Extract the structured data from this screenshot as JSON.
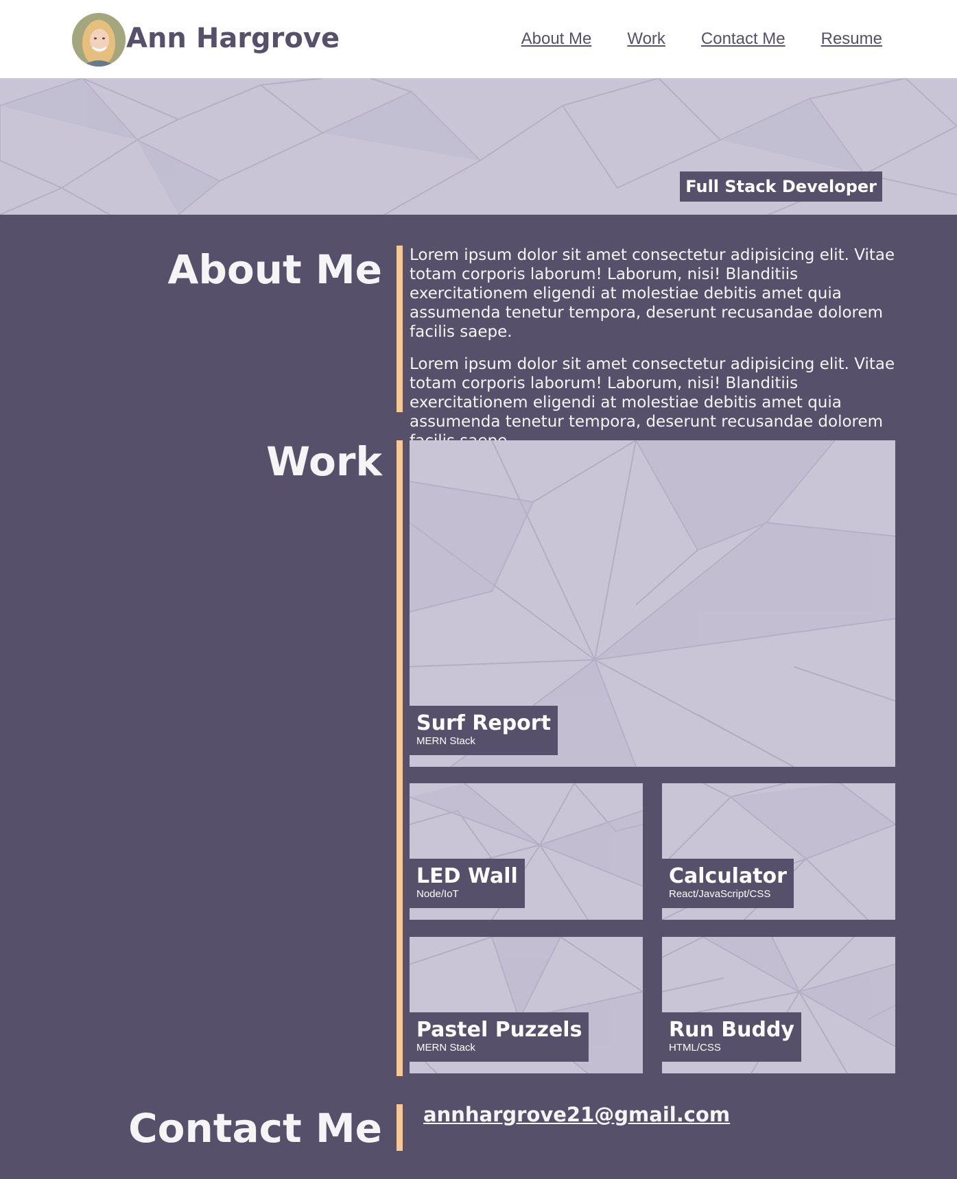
{
  "header": {
    "name": "Ann Hargrove",
    "nav": [
      {
        "label": "About Me"
      },
      {
        "label": "Work"
      },
      {
        "label": "Contact Me"
      },
      {
        "label": "Resume"
      }
    ]
  },
  "hero": {
    "badge": "Full Stack Developer"
  },
  "about": {
    "title": "About Me",
    "paragraphs": [
      "Lorem ipsum dolor sit amet consectetur adipisicing elit. Vitae totam corporis laborum! Laborum, nisi! Blanditiis exercitationem eligendi at molestiae debitis amet quia assumenda tenetur tempora, deserunt recusandae dolorem facilis saepe.",
      "Lorem ipsum dolor sit amet consectetur adipisicing elit. Vitae totam corporis laborum! Laborum, nisi! Blanditiis exercitationem eligendi at molestiae debitis amet quia assumenda tenetur tempora, deserunt recusandae dolorem facilis saepe."
    ]
  },
  "work": {
    "title": "Work",
    "projects": [
      {
        "title": "Surf Report",
        "stack": "MERN Stack"
      },
      {
        "title": "LED Wall",
        "stack": "Node/IoT"
      },
      {
        "title": "Calculator",
        "stack": "React/JavaScript/CSS"
      },
      {
        "title": "Pastel Puzzels",
        "stack": "MERN Stack"
      },
      {
        "title": "Run Buddy",
        "stack": "HTML/CSS"
      }
    ]
  },
  "contact": {
    "title": "Contact Me",
    "email": "annhargrove21@gmail.com"
  },
  "colors": {
    "primary": "#56506a",
    "accent": "#f6c996",
    "hero_bg": "#c9c5d6",
    "text_light": "#f5f5f5"
  }
}
